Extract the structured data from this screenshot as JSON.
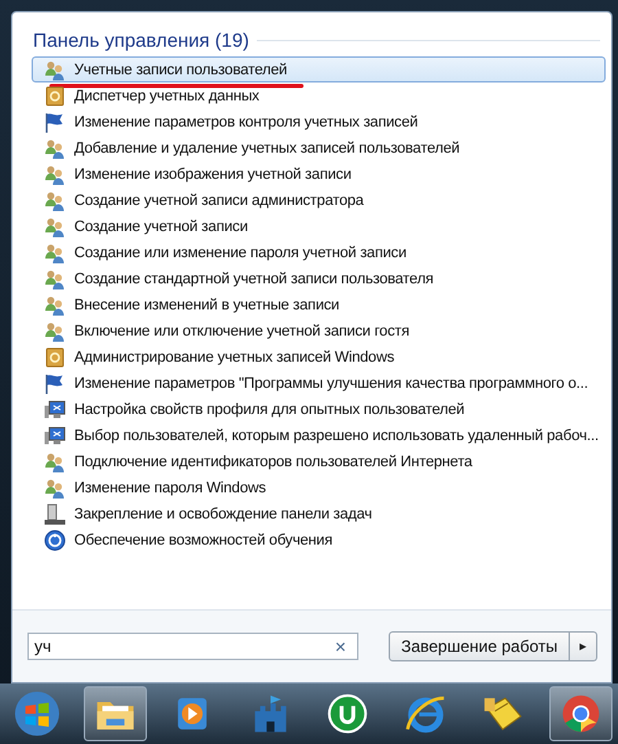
{
  "panel": {
    "heading": "Панель управления (19)"
  },
  "items": [
    {
      "label": "Учетные записи пользователей",
      "kind": "users",
      "selected": true,
      "underlined": true
    },
    {
      "label": "Диспетчер учетных данных",
      "kind": "vault",
      "selected": false,
      "underlined": false
    },
    {
      "label": "Изменение параметров контроля учетных записей",
      "kind": "flag",
      "selected": false,
      "underlined": false
    },
    {
      "label": "Добавление и удаление учетных записей пользователей",
      "kind": "users",
      "selected": false,
      "underlined": false
    },
    {
      "label": "Изменение изображения учетной записи",
      "kind": "users",
      "selected": false,
      "underlined": false
    },
    {
      "label": "Создание учетной записи администратора",
      "kind": "users",
      "selected": false,
      "underlined": false
    },
    {
      "label": "Создание учетной записи",
      "kind": "users",
      "selected": false,
      "underlined": false
    },
    {
      "label": "Создание или изменение пароля учетной записи",
      "kind": "users",
      "selected": false,
      "underlined": false
    },
    {
      "label": "Создание стандартной учетной записи пользователя",
      "kind": "users",
      "selected": false,
      "underlined": false
    },
    {
      "label": "Внесение изменений в учетные записи",
      "kind": "users",
      "selected": false,
      "underlined": false
    },
    {
      "label": "Включение или отключение учетной записи гостя",
      "kind": "users",
      "selected": false,
      "underlined": false
    },
    {
      "label": "Администрирование учетных записей Windows",
      "kind": "vault",
      "selected": false,
      "underlined": false
    },
    {
      "label": "Изменение параметров \"Программы улучшения качества программного о...",
      "kind": "flag",
      "selected": false,
      "underlined": false
    },
    {
      "label": "Настройка свойств профиля для опытных пользователей",
      "kind": "monitor",
      "selected": false,
      "underlined": false
    },
    {
      "label": "Выбор пользователей, которым разрешено использовать удаленный рабоч...",
      "kind": "monitor",
      "selected": false,
      "underlined": false
    },
    {
      "label": "Подключение идентификаторов пользователей Интернета",
      "kind": "users",
      "selected": false,
      "underlined": false
    },
    {
      "label": "Изменение пароля Windows",
      "kind": "users",
      "selected": false,
      "underlined": false
    },
    {
      "label": "Закрепление и освобождение панели задач",
      "kind": "taskbar",
      "selected": false,
      "underlined": false
    },
    {
      "label": "Обеспечение возможностей обучения",
      "kind": "ease",
      "selected": false,
      "underlined": false
    }
  ],
  "search": {
    "value": "уч",
    "clear": "×"
  },
  "shutdown": {
    "label": "Завершение работы",
    "arrow": "▸"
  },
  "taskbar": [
    {
      "kind": "start",
      "active": false
    },
    {
      "kind": "folder",
      "active": true
    },
    {
      "kind": "player",
      "active": false
    },
    {
      "kind": "castle",
      "active": false
    },
    {
      "kind": "torrent",
      "active": false
    },
    {
      "kind": "browser",
      "active": false
    },
    {
      "kind": "ticket",
      "active": false
    },
    {
      "kind": "chrome",
      "active": true
    }
  ]
}
